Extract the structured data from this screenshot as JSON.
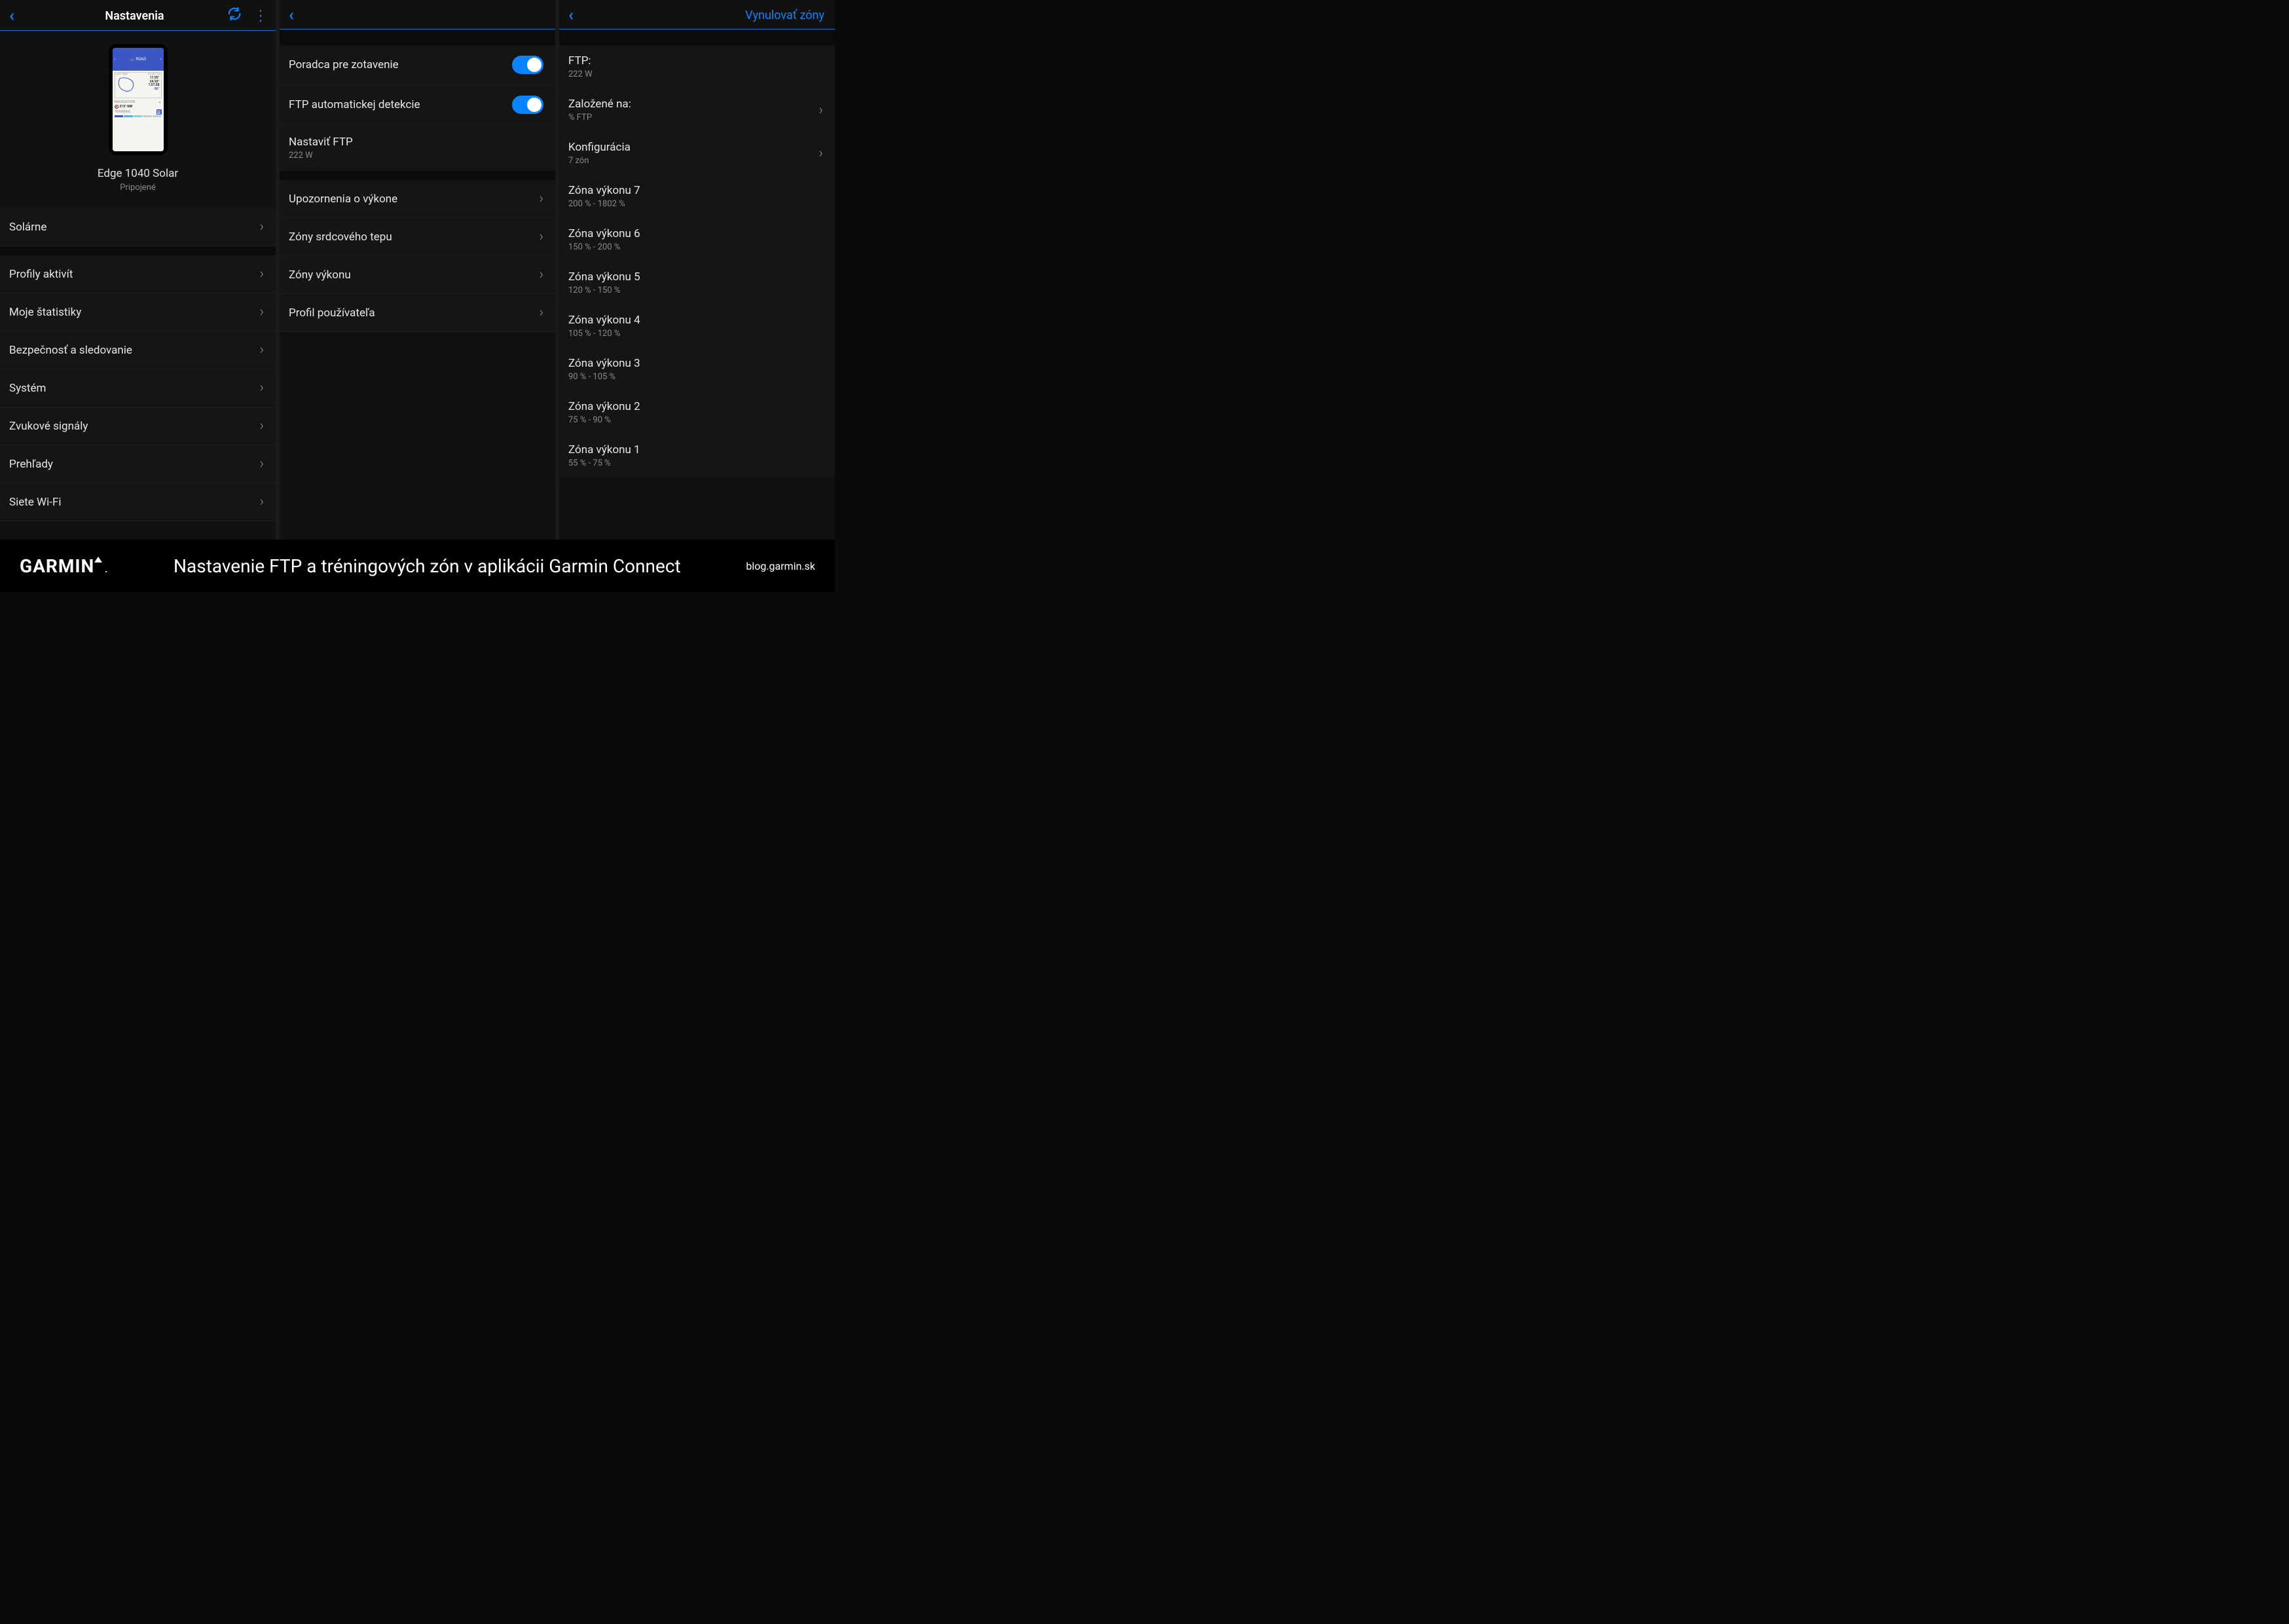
{
  "panel1": {
    "title": "Nastavenia",
    "device_name": "Edge 1040 Solar",
    "device_status": "Pripojené",
    "device_screen": {
      "mode": "ROAD",
      "last_ride": "LAST RIDE",
      "date": "21 OCT 22",
      "v1": "17.95°",
      "v2": "34.93°",
      "v3": "1:57:58",
      "v4": "86°",
      "nav": "NAVIGATION",
      "compass": "315° NW",
      "train": "TRAINING"
    },
    "rows": [
      {
        "label": "Solárne"
      },
      {
        "label": "Profily aktivít"
      },
      {
        "label": "Moje štatistiky"
      },
      {
        "label": "Bezpečnosť a sledovanie"
      },
      {
        "label": "Systém"
      },
      {
        "label": "Zvukové signály"
      },
      {
        "label": "Prehľady"
      },
      {
        "label": "Siete Wi-Fi"
      }
    ]
  },
  "panel2": {
    "toggle1": "Poradca pre zotavenie",
    "toggle2": "FTP automatickej detekcie",
    "ftp_label": "Nastaviť FTP",
    "ftp_value": "222 W",
    "rows": [
      {
        "label": "Upozornenia o výkone"
      },
      {
        "label": "Zóny srdcového tepu"
      },
      {
        "label": "Zóny výkonu"
      },
      {
        "label": "Profil používateľa"
      }
    ]
  },
  "panel3": {
    "reset": "Vynulovať zóny",
    "ftp_label": "FTP:",
    "ftp_value": "222 W",
    "based_label": "Založené na:",
    "based_value": "% FTP",
    "config_label": "Konfigurácia",
    "config_value": "7 zón",
    "zones": [
      {
        "label": "Zóna výkonu 7",
        "range": "200 % - 1802 %"
      },
      {
        "label": "Zóna výkonu 6",
        "range": "150 % - 200 %"
      },
      {
        "label": "Zóna výkonu 5",
        "range": "120 % - 150 %"
      },
      {
        "label": "Zóna výkonu 4",
        "range": "105 % - 120 %"
      },
      {
        "label": "Zóna výkonu 3",
        "range": "90 % - 105 %"
      },
      {
        "label": "Zóna výkonu 2",
        "range": "75 % - 90 %"
      },
      {
        "label": "Zóna výkonu 1",
        "range": "55 % - 75 %"
      }
    ]
  },
  "banner": {
    "brand": "GARMIN",
    "text": "Nastavenie FTP a tréningových zón v aplikácii Garmin Connect",
    "site": "blog.garmin.sk"
  }
}
